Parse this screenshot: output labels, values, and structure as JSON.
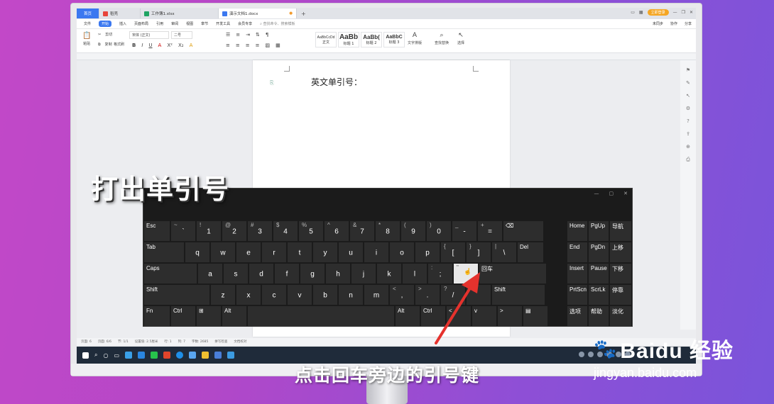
{
  "tabs": [
    {
      "label": "首页",
      "kind": "home"
    },
    {
      "label": "稻壳",
      "color": "#e8453c"
    },
    {
      "label": "工作簿1.xlsx",
      "color": "#1fa463"
    },
    {
      "label": "演示文档1.docx",
      "color": "#3b78f0",
      "active": true
    }
  ],
  "title_right": {
    "login": "立即登录"
  },
  "menu": {
    "file": "文件",
    "items": [
      "开始",
      "插入",
      "页面布局",
      "引用",
      "审阅",
      "视图",
      "章节",
      "开发工具",
      "会员专享"
    ],
    "search": "查找命令、搜索模板",
    "right": [
      "未同步",
      "协作",
      "分享"
    ]
  },
  "toolbar": {
    "paste": "粘贴",
    "cut": "剪切",
    "copy": "复制",
    "format_painter": "格式刷",
    "font_name": "宋体 (正文)",
    "font_size": "二号",
    "styles": [
      {
        "preview": "AaBbCcDd",
        "name": "正文"
      },
      {
        "preview": "AaBb",
        "name": "标题 1"
      },
      {
        "preview": "AaBb(",
        "name": "标题 2"
      },
      {
        "preview": "AaBbC",
        "name": "标题 3"
      }
    ],
    "text_tools": "文字排版",
    "find_replace": "查找替换",
    "select": "选择"
  },
  "document": {
    "text": "英文单引号："
  },
  "statusbar": [
    "页面: 6",
    "页面: 6/6",
    "节: 1/1",
    "设置值: 2.5厘米",
    "行: 1",
    "列: 7",
    "字数: 2685",
    "拼写检查",
    "文档校对"
  ],
  "caption": "打出单引号",
  "subtitle": "点击回车旁边的引号键",
  "watermark": {
    "brand": "Baidu 经验",
    "url": "jingyan.baidu.com"
  },
  "keyboard": {
    "rows": [
      [
        {
          "label": "Esc"
        },
        {
          "shift": "~",
          "base": "`"
        },
        {
          "shift": "!",
          "base": "1"
        },
        {
          "shift": "@",
          "base": "2"
        },
        {
          "shift": "#",
          "base": "3"
        },
        {
          "shift": "$",
          "base": "4"
        },
        {
          "shift": "%",
          "base": "5"
        },
        {
          "shift": "^",
          "base": "6"
        },
        {
          "shift": "&",
          "base": "7"
        },
        {
          "shift": "*",
          "base": "8"
        },
        {
          "shift": "(",
          "base": "9"
        },
        {
          "shift": ")",
          "base": "0"
        },
        {
          "shift": "_",
          "base": "-"
        },
        {
          "shift": "+",
          "base": "="
        },
        {
          "label": "⌫"
        }
      ],
      [
        {
          "label": "Tab"
        },
        {
          "base": "q"
        },
        {
          "base": "w"
        },
        {
          "base": "e"
        },
        {
          "base": "r"
        },
        {
          "base": "t"
        },
        {
          "base": "y"
        },
        {
          "base": "u"
        },
        {
          "base": "i"
        },
        {
          "base": "o"
        },
        {
          "base": "p"
        },
        {
          "shift": "{",
          "base": "["
        },
        {
          "shift": "}",
          "base": "]"
        },
        {
          "shift": "|",
          "base": "\\"
        },
        {
          "label": "Del"
        }
      ],
      [
        {
          "label": "Caps"
        },
        {
          "base": "a"
        },
        {
          "base": "s"
        },
        {
          "base": "d"
        },
        {
          "base": "f"
        },
        {
          "base": "g"
        },
        {
          "base": "h"
        },
        {
          "base": "j"
        },
        {
          "base": "k"
        },
        {
          "base": "l"
        },
        {
          "shift": ":",
          "base": ";"
        },
        {
          "shift": "\"",
          "base": "'",
          "highlight": true
        },
        {
          "label": "回车"
        }
      ],
      [
        {
          "label": "Shift"
        },
        {
          "base": "z"
        },
        {
          "base": "x"
        },
        {
          "base": "c"
        },
        {
          "base": "v"
        },
        {
          "base": "b"
        },
        {
          "base": "n"
        },
        {
          "base": "m"
        },
        {
          "shift": "<",
          "base": ","
        },
        {
          "shift": ">",
          "base": "."
        },
        {
          "shift": "?",
          "base": "/"
        },
        {
          "label": "^"
        },
        {
          "label": "Shift"
        }
      ],
      [
        {
          "label": "Fn"
        },
        {
          "label": "Ctrl"
        },
        {
          "label": "⊞"
        },
        {
          "label": "Alt"
        },
        {
          "label": ""
        },
        {
          "label": "Alt"
        },
        {
          "label": "Ctrl"
        },
        {
          "label": "<"
        },
        {
          "label": "v"
        },
        {
          "label": ">"
        },
        {
          "label": "▤"
        }
      ]
    ],
    "nav": [
      [
        "Home",
        "PgUp",
        "导航"
      ],
      [
        "End",
        "PgDn",
        "上移"
      ],
      [
        "Insert",
        "Pause",
        "下移"
      ],
      [
        "PrtScn",
        "ScrLk",
        "停靠"
      ],
      [
        "选项",
        "帮助",
        "淡化"
      ]
    ]
  }
}
